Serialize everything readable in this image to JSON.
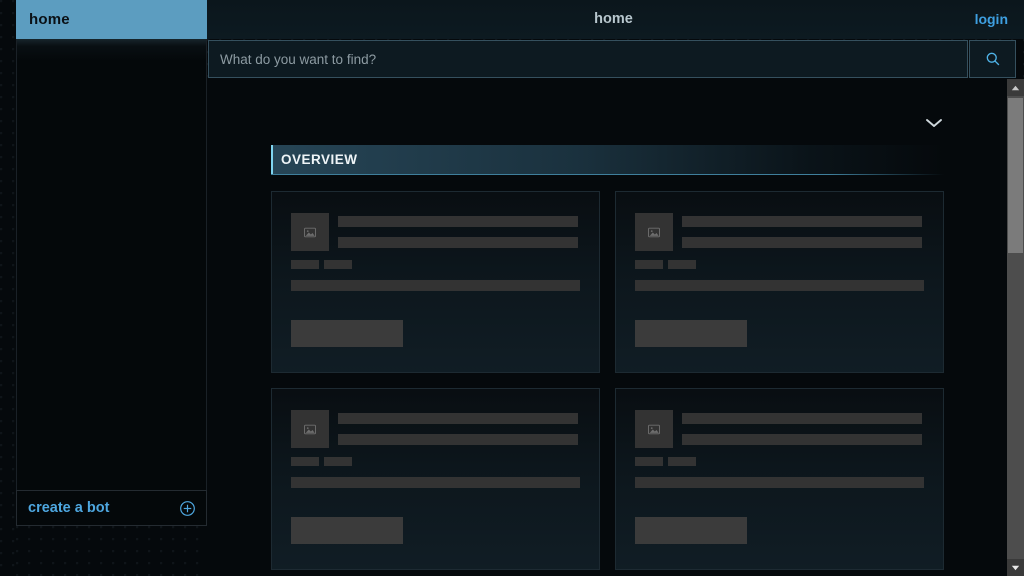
{
  "sidebar": {
    "header_label": "home",
    "create_bot_label": "create a bot",
    "create_bot_icon": "plus-circle-icon",
    "accent_color": "#5c9dc0",
    "link_color": "#4ea7e0"
  },
  "topbar": {
    "title": "home",
    "login_label": "login",
    "login_color": "#3e9fe0"
  },
  "search": {
    "placeholder": "What do you want to find?",
    "value": "",
    "button_icon": "search-icon"
  },
  "content": {
    "collapse_icon": "chevron-down-icon",
    "section_title": "OVERVIEW",
    "section_accent_color": "#7fd4f0",
    "cards": [
      {
        "state": "loading",
        "thumb_icon": "picture-placeholder-icon"
      },
      {
        "state": "loading",
        "thumb_icon": "picture-placeholder-icon"
      },
      {
        "state": "loading",
        "thumb_icon": "picture-placeholder-icon"
      },
      {
        "state": "loading",
        "thumb_icon": "picture-placeholder-icon"
      }
    ]
  },
  "scrollbar": {
    "up_icon": "triangle-up-icon",
    "down_icon": "triangle-down-icon",
    "thumb_label": "scrollbar-thumb"
  }
}
